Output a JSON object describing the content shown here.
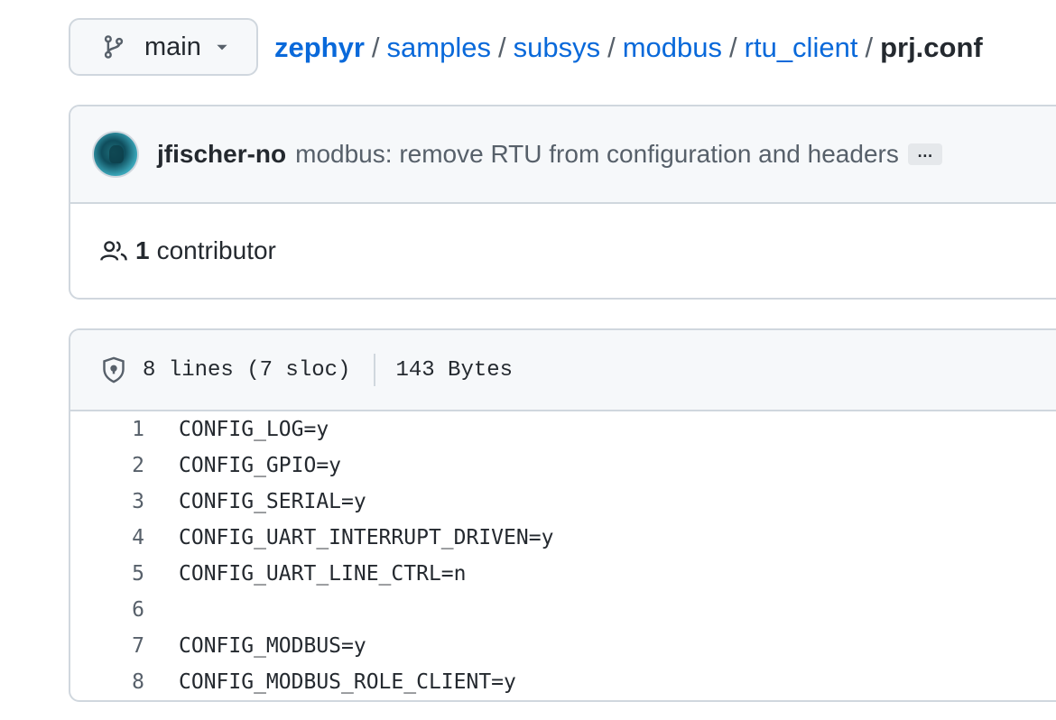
{
  "branch": {
    "name": "main",
    "icon": "git-branch-icon"
  },
  "breadcrumb": {
    "items": [
      "zephyr",
      "samples",
      "subsys",
      "modbus",
      "rtu_client"
    ],
    "separator": "/",
    "file": "prj.conf"
  },
  "commit": {
    "author": "jfischer-no",
    "message": "modbus: remove RTU from configuration and headers",
    "more_label": "…"
  },
  "contributors": {
    "count": "1",
    "label": "contributor"
  },
  "file_info": {
    "lines_text": "8 lines (7 sloc)",
    "size_text": "143 Bytes"
  },
  "code_lines": [
    {
      "num": "1",
      "text": "CONFIG_LOG=y"
    },
    {
      "num": "2",
      "text": "CONFIG_GPIO=y"
    },
    {
      "num": "3",
      "text": "CONFIG_SERIAL=y"
    },
    {
      "num": "4",
      "text": "CONFIG_UART_INTERRUPT_DRIVEN=y"
    },
    {
      "num": "5",
      "text": "CONFIG_UART_LINE_CTRL=n"
    },
    {
      "num": "6",
      "text": ""
    },
    {
      "num": "7",
      "text": "CONFIG_MODBUS=y"
    },
    {
      "num": "8",
      "text": "CONFIG_MODBUS_ROLE_CLIENT=y"
    }
  ],
  "colors": {
    "link": "#0969da",
    "border": "#d0d7de",
    "muted": "#57606a",
    "panel": "#f6f8fa"
  }
}
